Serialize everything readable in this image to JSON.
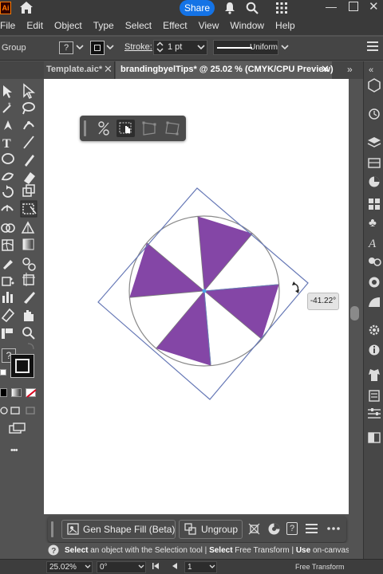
{
  "app": {
    "logo_text": "Ai",
    "share_label": "Share"
  },
  "menu": [
    "File",
    "Edit",
    "Object",
    "Type",
    "Select",
    "Effect",
    "View",
    "Window",
    "Help"
  ],
  "control_bar": {
    "selection_label": "Group",
    "fill_value": "?",
    "stroke_label": "Stroke:",
    "stroke_weight": "1 pt",
    "profile_label": "Uniform"
  },
  "tabs": [
    {
      "label": "Template.aic*",
      "active": false
    },
    {
      "label": "brandingbyelTips* @ 25.02 % (CMYK/CPU Preview)",
      "active": true
    }
  ],
  "tab_overflow": "»",
  "canvas": {
    "rotation_readout": "-41.22°",
    "wedge_color": "#8446a6",
    "bbox_color": "#6678b6"
  },
  "toolbar_left": {
    "fill_question": "?",
    "overflow": "•••"
  },
  "taskbar": {
    "gen_fill_label": "Gen Shape Fill (Beta)",
    "ungroup_label": "Ungroup"
  },
  "hint": {
    "part1_bold": "Select",
    "part1": " an object with the Selection tool",
    "sep1": " | ",
    "part2_bold": "Select",
    "part2": " Free Transform",
    "sep2": " | ",
    "part3_bold": "Use",
    "part3": " on-canvas widg"
  },
  "status": {
    "zoom": "25.02%",
    "rotation": "0°",
    "artboard": "1",
    "tool": "Free Transform"
  },
  "colors": {
    "accent": "#1473e6",
    "app_bar": "#3a3a3a",
    "panel": "#535353",
    "canvas": "#ffffff"
  }
}
